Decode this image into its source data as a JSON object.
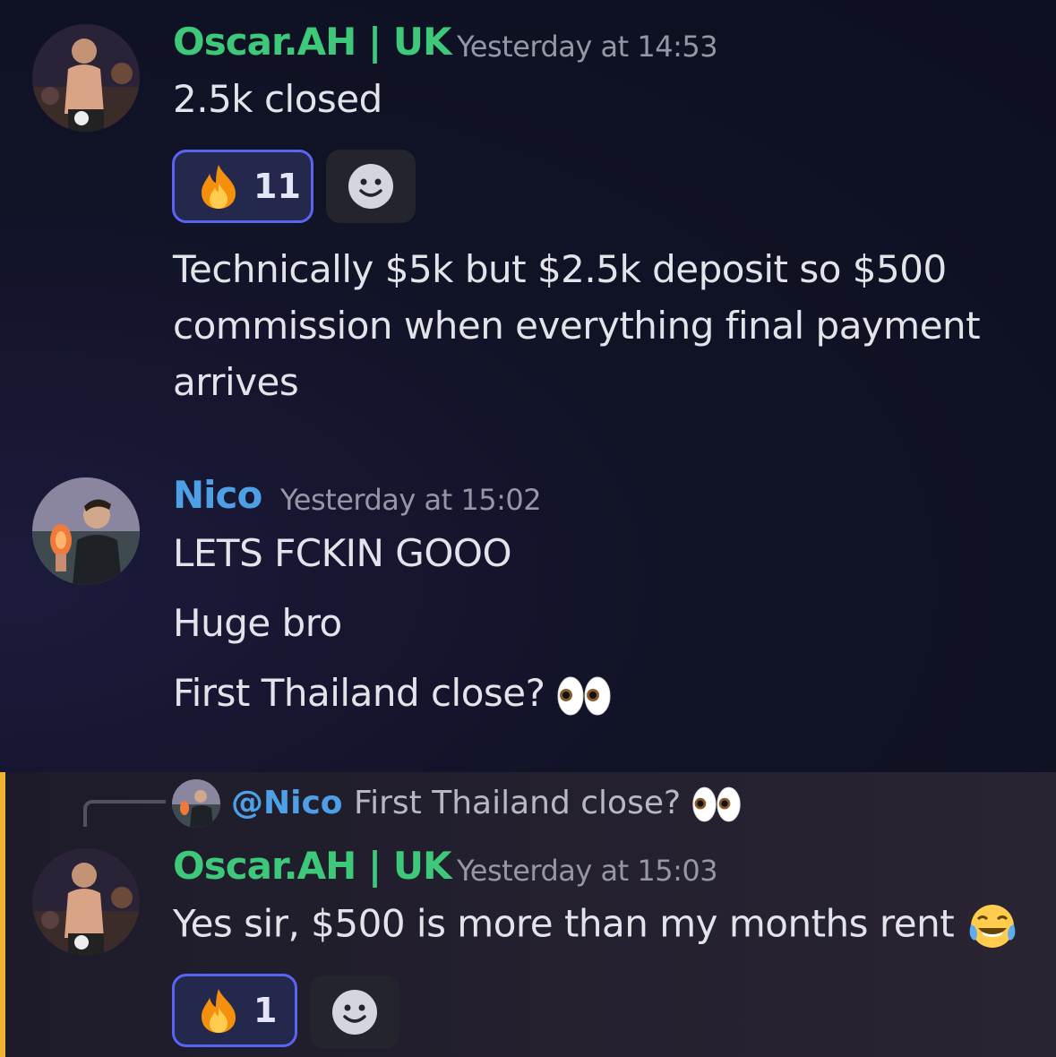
{
  "messages": [
    {
      "author": "Oscar.AH | UK",
      "timestamp": "Yesterday at 14:53",
      "lines": [
        "2.5k closed"
      ],
      "reaction": {
        "emoji": "fire-emoji",
        "count": "11"
      },
      "followup": [
        "Technically $5k but $2.5k deposit so $500",
        "commission when everything final payment",
        "arrives"
      ]
    },
    {
      "author": "Nico",
      "timestamp": "Yesterday at 15:02",
      "lines": [
        "LETS FCKIN GOOO",
        "Huge bro",
        "First Thailand close?"
      ]
    },
    {
      "reply_to": {
        "mention": "@Nico",
        "text": "First Thailand close?"
      },
      "author": "Oscar.AH | UK",
      "timestamp": "Yesterday at 15:03",
      "lines": [
        "Yes sir, $500 is more than my months rent"
      ],
      "reaction": {
        "emoji": "fire-emoji",
        "count": "1"
      }
    }
  ],
  "colors": {
    "oscar_name": "#3ec87a",
    "nico_name": "#4ea0e6",
    "mention": "#4ea0e6",
    "reaction_border": "#5865f2",
    "highlight_bar": "#f0b232"
  }
}
